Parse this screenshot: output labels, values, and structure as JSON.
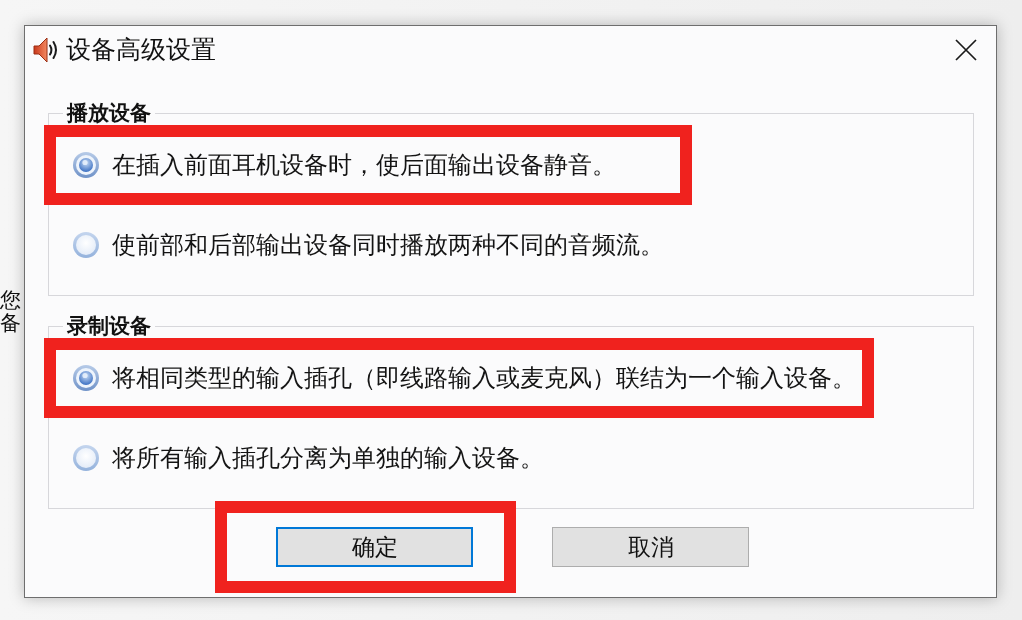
{
  "background_text": [
    "您",
    "备"
  ],
  "dialog": {
    "title": "设备高级设置"
  },
  "groups": [
    {
      "title": "播放设备",
      "options": [
        {
          "label": "在插入前面耳机设备时，使后面输出设备静音。",
          "selected": true,
          "highlighted": true
        },
        {
          "label": "使前部和后部输出设备同时播放两种不同的音频流。",
          "selected": false,
          "highlighted": false
        }
      ]
    },
    {
      "title": "录制设备",
      "options": [
        {
          "label": "将相同类型的输入插孔（即线路输入或麦克风）联结为一个输入设备。",
          "selected": true,
          "highlighted": true
        },
        {
          "label": "将所有输入插孔分离为单独的输入设备。",
          "selected": false,
          "highlighted": false
        }
      ]
    }
  ],
  "buttons": [
    {
      "label": "确定",
      "default": true,
      "highlighted": true
    },
    {
      "label": "取消",
      "default": false,
      "highlighted": false
    }
  ]
}
